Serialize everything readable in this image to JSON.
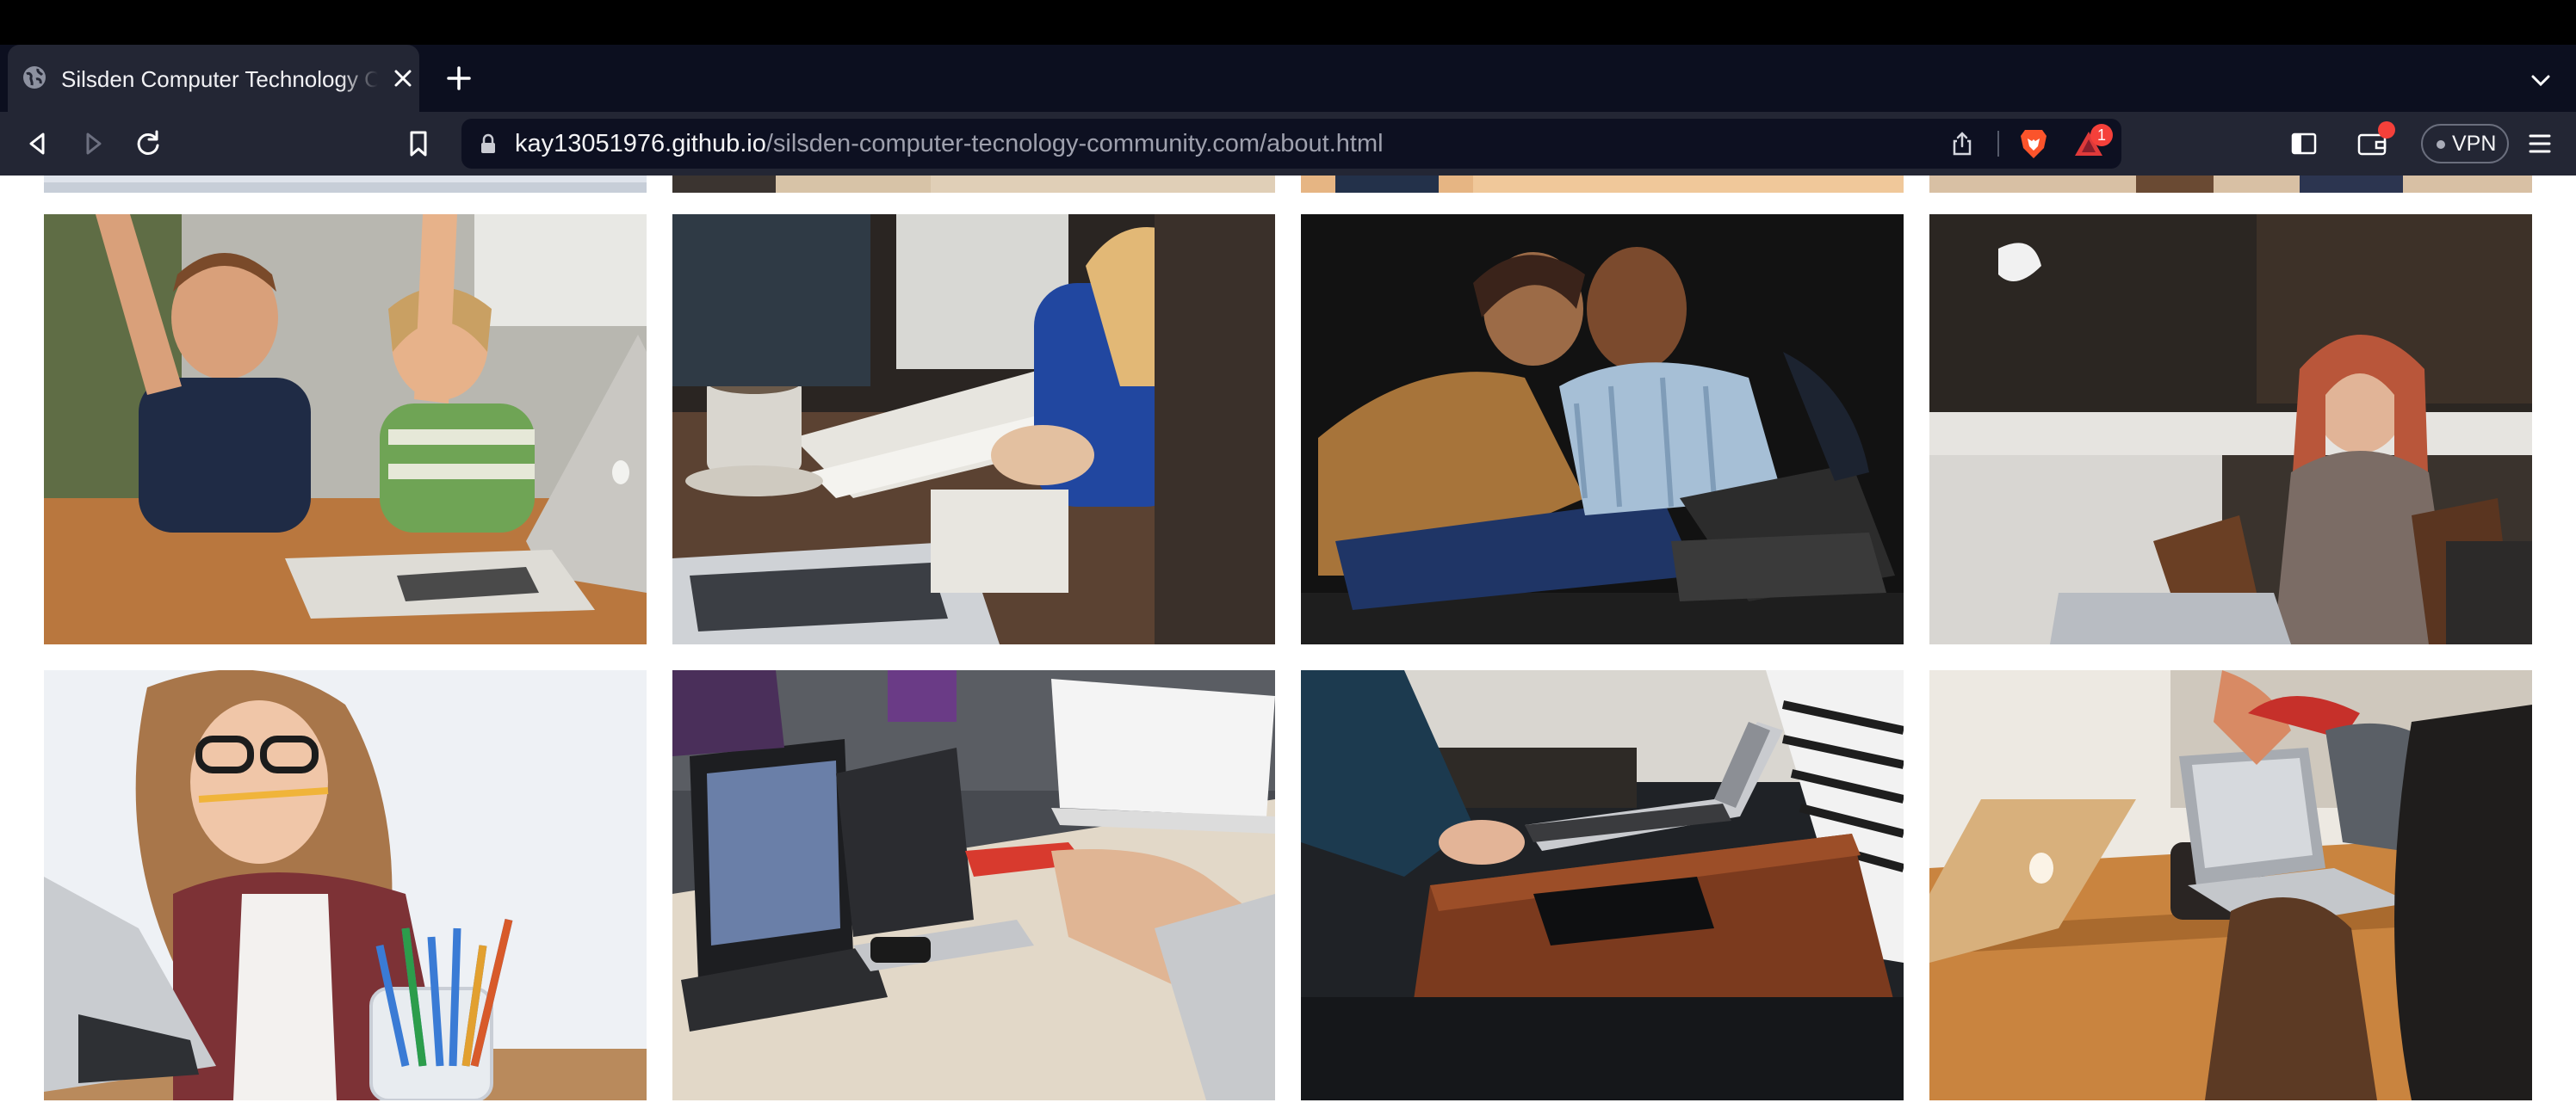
{
  "browser": {
    "tab": {
      "title": "Silsden Computer Technology Community",
      "favicon": "globe-icon",
      "close_icon": "close-icon"
    },
    "new_tab_icon": "plus-icon",
    "tab_list_icon": "chevron-down-icon",
    "toolbar": {
      "back_icon": "back-arrow-icon",
      "forward_icon": "forward-arrow-icon",
      "reload_icon": "reload-icon",
      "bookmark_icon": "bookmark-icon"
    },
    "url": {
      "host": "kay13051976.github.io",
      "path": "/silsden-computer-tecnology-community.com/about.html",
      "lock_icon": "lock-icon"
    },
    "share_icon": "share-icon",
    "brave_shields_icon": "brave-lion-icon",
    "rewards": {
      "icon": "brave-rewards-triangle-icon",
      "badge": "1"
    },
    "sidebar_icon": "sidebar-toggle-icon",
    "wallet": {
      "icon": "wallet-icon",
      "notification": "red-dot"
    },
    "vpn": {
      "label": "VPN"
    },
    "menu_icon": "hamburger-menu-icon"
  },
  "gallery": {
    "partial_row": [
      {
        "name": "photo-partial-1"
      },
      {
        "name": "photo-partial-2"
      },
      {
        "name": "photo-partial-3"
      },
      {
        "name": "photo-partial-4"
      }
    ],
    "photos": [
      {
        "name": "photo-kids-cheering-laptop"
      },
      {
        "name": "photo-notebook-coffee-meeting"
      },
      {
        "name": "photo-couple-laptop"
      },
      {
        "name": "photo-woman-cafe-laptop"
      },
      {
        "name": "photo-woman-glasses-pencil"
      },
      {
        "name": "photo-laptops-meeting-table"
      },
      {
        "name": "photo-laptop-keyboard-desk"
      },
      {
        "name": "photo-cafe-macbook-mug"
      }
    ]
  },
  "colors": {
    "tabbar_bg": "#0c0f1f",
    "toolbar_bg": "#232634",
    "urlbar_bg": "#0d1021",
    "badge_red": "#f5403a",
    "brave_orange": "#fb542b"
  }
}
